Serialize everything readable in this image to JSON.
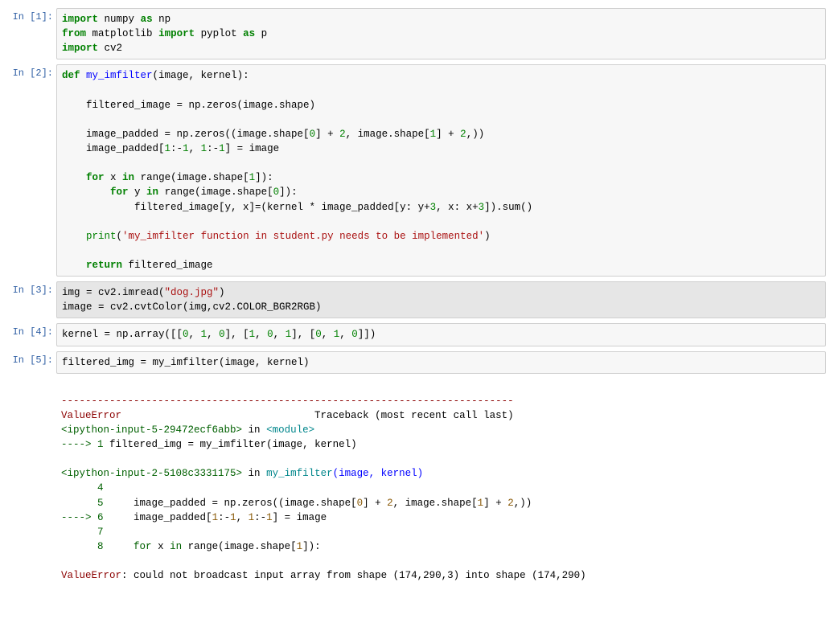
{
  "cells": [
    {
      "prompt": "In [1]:"
    },
    {
      "prompt": "In [2]:"
    },
    {
      "prompt": "In [3]:"
    },
    {
      "prompt": "In [4]:"
    },
    {
      "prompt": "In [5]:"
    }
  ],
  "code": {
    "c1": {
      "import1a": "import",
      "np_pkg": "numpy",
      "as1": "as",
      "np_alias": "np",
      "from2": "from",
      "mpl_pkg": "matplotlib",
      "import2b": "import",
      "pyplot": "pyplot",
      "as2": "as",
      "p_alias": "p",
      "import3": "import",
      "cv2_pkg": "cv2"
    },
    "c2": {
      "def": "def",
      "fn": "my_imfilter",
      "params": "(image, kernel):",
      "l_fi": "    filtered_image = np.zeros(image.shape)",
      "l_pad": "    image_padded = np.zeros((image.shape[",
      "l_pad_0": "0",
      "l_pad_mid": "] + ",
      "l_pad_2a": "2",
      "l_pad_mid2": ", image.shape[",
      "l_pad_1": "1",
      "l_pad_mid3": "] + ",
      "l_pad_2b": "2",
      "l_pad_end": ",))",
      "l_assign": "    image_padded[",
      "l_assign_1a": "1",
      "l_assign_mid": ":-",
      "l_assign_1b": "1",
      "l_assign_c": ", ",
      "l_assign_1c": "1",
      "l_assign_mid2": ":-",
      "l_assign_1d": "1",
      "l_assign_end": "] = image",
      "for1": "for",
      "for1_rest": " x ",
      "in1": "in",
      "for1_tail": " range(image.shape[",
      "for1_1": "1",
      "for1_end": "]):",
      "for2_indent": "        ",
      "for2": "for",
      "for2_rest": " y ",
      "in2": "in",
      "for2_tail": " range(image.shape[",
      "for2_0": "0",
      "for2_end": "]):",
      "inner": "            filtered_image[y, x]=(kernel * image_padded[y: y+",
      "inner_3a": "3",
      "inner_m": ", x: x+",
      "inner_3b": "3",
      "inner_end": "]).sum()",
      "print_kw": "print",
      "print_arg": "'my_imfilter function in student.py needs to be implemented'",
      "return": "return",
      "return_rest": " filtered_image"
    },
    "c3": {
      "l1_a": "img = cv2.imread(",
      "l1_str": "\"dog.jpg\"",
      "l1_b": ")",
      "l2": "image = cv2.cvtColor(img,cv2.COLOR_BGR2RGB)"
    },
    "c4": {
      "l1_a": "kernel = np.array([[",
      "n0a": "0",
      "c": ", ",
      "n1a": "1",
      "n0b": "0",
      "mid1": "], [",
      "n1b": "1",
      "n0c": "0",
      "n1c": "1",
      "mid2": "], [",
      "n0d": "0",
      "n1d": "1",
      "n0e": "0",
      "end": "]])"
    },
    "c5": {
      "l1": "filtered_img = my_imfilter(image, kernel)"
    }
  },
  "traceback": {
    "dash": "---------------------------------------------------------------------------",
    "err_name": "ValueError",
    "tb_label": "                                Traceback (most recent call last)",
    "frame1_loc": "<ipython-input-5-29472ecf6abb>",
    "frame1_in": " in ",
    "frame1_mod": "<module>",
    "arrow": "----> ",
    "f1_line1_no": "1",
    "f1_line1": " filtered_img = my_imfilter(image, kernel)",
    "frame2_loc": "<ipython-input-2-5108c3331175>",
    "frame2_in": " in ",
    "frame2_fn": "my_imfilter",
    "frame2_args": "(image, kernel)",
    "f2_l4_no": "4",
    "f2_l5_no": "5",
    "f2_l5": "     image_padded = np.zeros((image.shape[",
    "f2_l5_0": "0",
    "f2_l5_mid": "] + ",
    "f2_l5_2a": "2",
    "f2_l5_mid2": ", image.shape[",
    "f2_l5_1": "1",
    "f2_l5_mid3": "] + ",
    "f2_l5_2b": "2",
    "f2_l5_end": ",))",
    "f2_l6_no": "6",
    "f2_l6": "     image_padded[",
    "f2_l6_1a": "1",
    "f2_l6_m": ":-",
    "f2_l6_1b": "1",
    "f2_l6_c": ", ",
    "f2_l6_1c": "1",
    "f2_l6_m2": ":-",
    "f2_l6_1d": "1",
    "f2_l6_end": "] = image",
    "f2_l7_no": "7",
    "f2_l8_no": "8",
    "f2_l8_for": "for",
    "f2_l8_rest": " x ",
    "f2_l8_in": "in",
    "f2_l8_tail": " range(image.shape[",
    "f2_l8_1": "1",
    "f2_l8_end": "]):",
    "final_err": "ValueError",
    "final_msg": ": could not broadcast input array from shape (174,290,3) into shape (174,290)"
  }
}
